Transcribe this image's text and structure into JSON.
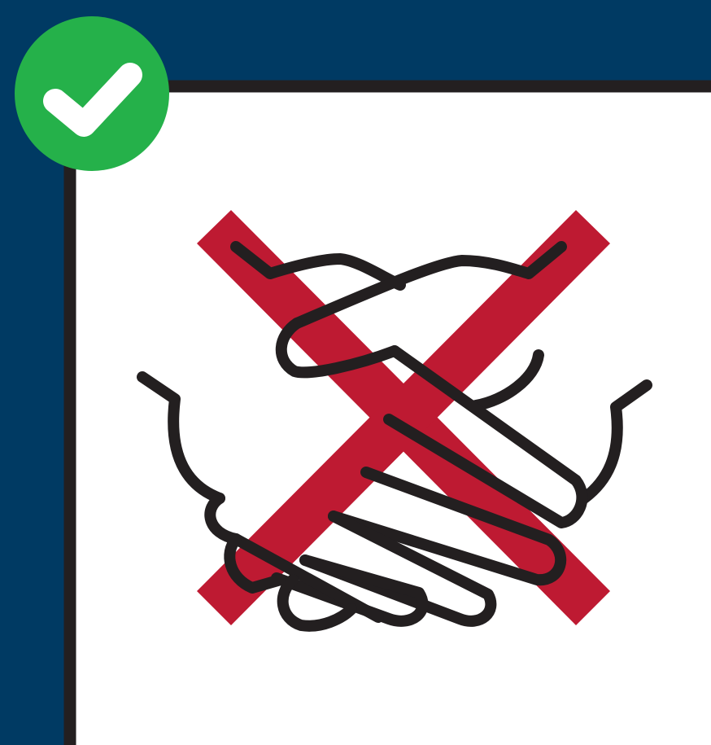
{
  "illustration": {
    "background_color": "#003A63",
    "card_color": "#FFFFFF",
    "card_border_color": "#231F20",
    "badge": {
      "icon": "check-icon",
      "color": "#25B14A",
      "mark_color": "#FFFFFF"
    },
    "subject": {
      "icon": "handshake-icon",
      "stroke_color": "#231F20",
      "fill_color": "#FFFFFF"
    },
    "prohibition": {
      "icon": "cross-mark-icon",
      "color": "#BE1A32"
    }
  }
}
